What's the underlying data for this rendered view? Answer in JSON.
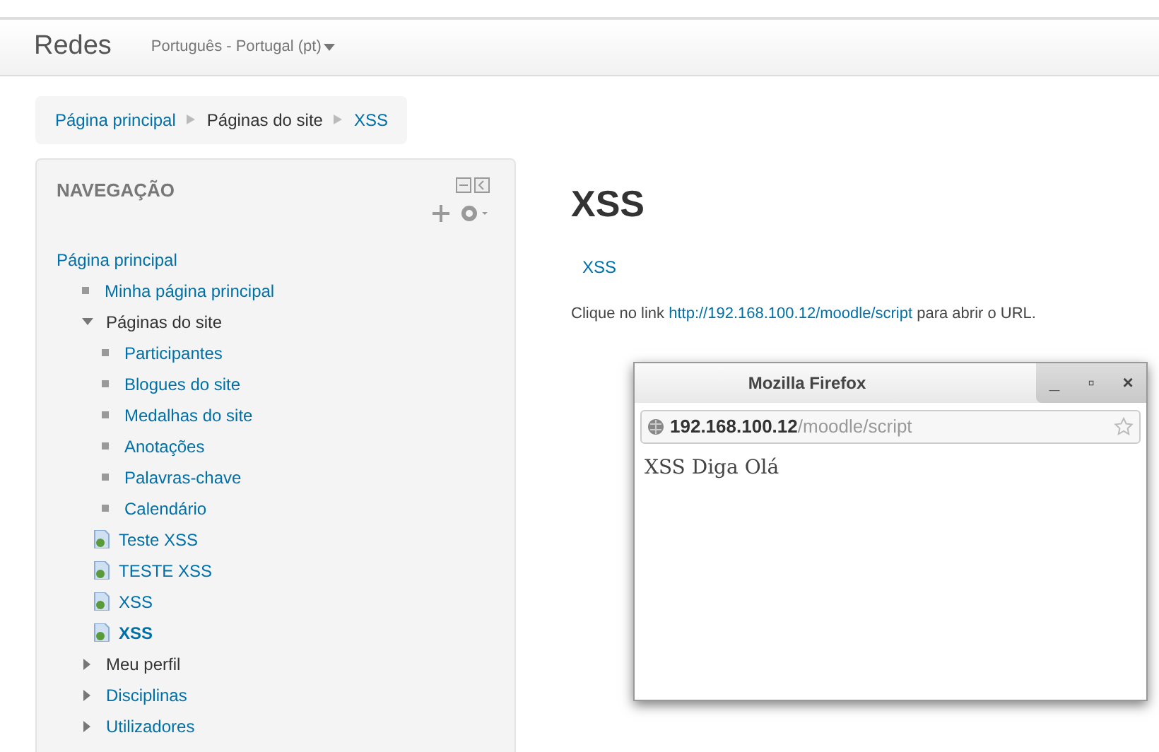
{
  "navbar": {
    "brand": "Redes",
    "language": "Português - Portugal (pt)"
  },
  "breadcrumb": [
    {
      "label": "Página principal",
      "link": true
    },
    {
      "label": "Páginas do site",
      "link": false
    },
    {
      "label": "XSS",
      "link": true
    }
  ],
  "navigation": {
    "title": "NAVEGAÇÃO",
    "items": [
      {
        "label": "Página principal",
        "kind": "root",
        "link": true,
        "selected": false
      },
      {
        "label": "Minha página principal",
        "kind": "leaf",
        "link": true,
        "selected": false
      },
      {
        "label": "Páginas do site",
        "kind": "branch",
        "link": false,
        "expanded": true,
        "selected": false,
        "children": [
          {
            "label": "Participantes",
            "kind": "leaf",
            "link": true,
            "selected": false
          },
          {
            "label": "Blogues do site",
            "kind": "leaf",
            "link": true,
            "selected": false
          },
          {
            "label": "Medalhas do site",
            "kind": "leaf",
            "link": true,
            "selected": false
          },
          {
            "label": "Anotações",
            "kind": "leaf",
            "link": true,
            "selected": false
          },
          {
            "label": "Palavras-chave",
            "kind": "leaf",
            "link": true,
            "selected": false
          },
          {
            "label": "Calendário",
            "kind": "leaf",
            "link": true,
            "selected": false
          },
          {
            "label": "Teste XSS",
            "kind": "page",
            "link": true,
            "selected": false
          },
          {
            "label": "TESTE XSS",
            "kind": "page",
            "link": true,
            "selected": false
          },
          {
            "label": "XSS",
            "kind": "page",
            "link": true,
            "selected": false
          },
          {
            "label": "XSS",
            "kind": "page",
            "link": true,
            "selected": true
          }
        ]
      },
      {
        "label": "Meu perfil",
        "kind": "branch",
        "link": false,
        "expanded": false,
        "selected": false
      },
      {
        "label": "Disciplinas",
        "kind": "branch",
        "link": true,
        "expanded": false,
        "selected": false
      },
      {
        "label": "Utilizadores",
        "kind": "branch",
        "link": true,
        "expanded": false,
        "selected": false
      }
    ]
  },
  "main": {
    "heading": "XSS",
    "link": "XSS",
    "sentence": {
      "before": "Clique no link",
      "link": "http://192.168.100.12/moodle/script",
      "after": "para abrir o URL."
    }
  },
  "popup": {
    "title": "Mozilla Firefox",
    "controls": [
      "_",
      "▫",
      "×"
    ],
    "url": "**192.168.100.12**/moodle/script",
    "content": "XSS Diga Olá"
  }
}
